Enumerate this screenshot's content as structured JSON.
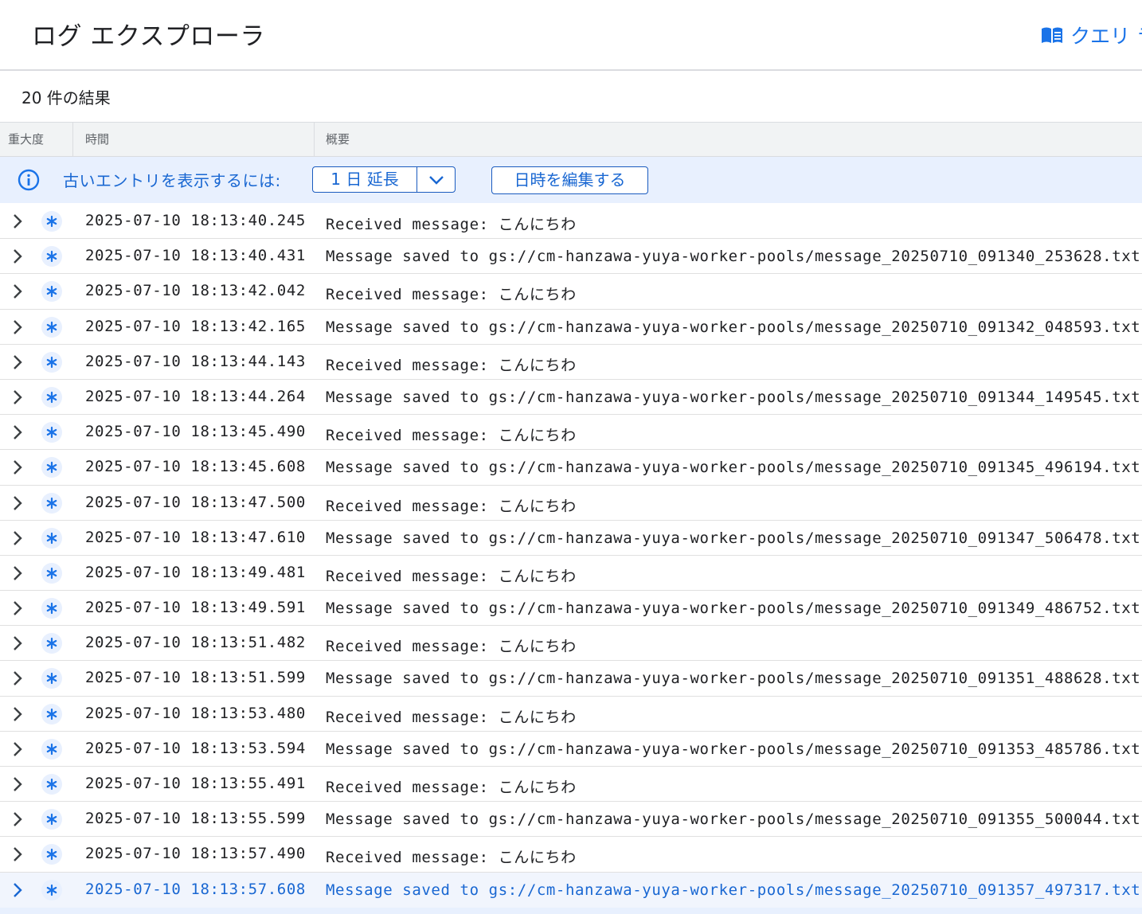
{
  "header": {
    "title": "ログ エクスプローラ",
    "query_link": "クエリ ラ",
    "query_icon": "library-book-icon"
  },
  "results": {
    "count_label": "20 件の結果"
  },
  "columns": {
    "severity": "重大度",
    "time": "時間",
    "summary": "概要"
  },
  "banner": {
    "icon": "info-icon",
    "text": "古いエントリを表示するには:",
    "extend_label": "1 日 延長",
    "edit_label": "日時を編集する"
  },
  "colors": {
    "accent": "#1a73e8",
    "banner_bg": "#e8f0fe",
    "severity_icon": "#1a73e8"
  },
  "rows": [
    {
      "time": "2025-07-10 18:13:40.245",
      "message": "Received message: こんにちわ"
    },
    {
      "time": "2025-07-10 18:13:40.431",
      "message": "Message saved to gs://cm-hanzawa-yuya-worker-pools/message_20250710_091340_253628.txt"
    },
    {
      "time": "2025-07-10 18:13:42.042",
      "message": "Received message: こんにちわ"
    },
    {
      "time": "2025-07-10 18:13:42.165",
      "message": "Message saved to gs://cm-hanzawa-yuya-worker-pools/message_20250710_091342_048593.txt"
    },
    {
      "time": "2025-07-10 18:13:44.143",
      "message": "Received message: こんにちわ"
    },
    {
      "time": "2025-07-10 18:13:44.264",
      "message": "Message saved to gs://cm-hanzawa-yuya-worker-pools/message_20250710_091344_149545.txt"
    },
    {
      "time": "2025-07-10 18:13:45.490",
      "message": "Received message: こんにちわ"
    },
    {
      "time": "2025-07-10 18:13:45.608",
      "message": "Message saved to gs://cm-hanzawa-yuya-worker-pools/message_20250710_091345_496194.txt"
    },
    {
      "time": "2025-07-10 18:13:47.500",
      "message": "Received message: こんにちわ"
    },
    {
      "time": "2025-07-10 18:13:47.610",
      "message": "Message saved to gs://cm-hanzawa-yuya-worker-pools/message_20250710_091347_506478.txt"
    },
    {
      "time": "2025-07-10 18:13:49.481",
      "message": "Received message: こんにちわ"
    },
    {
      "time": "2025-07-10 18:13:49.591",
      "message": "Message saved to gs://cm-hanzawa-yuya-worker-pools/message_20250710_091349_486752.txt"
    },
    {
      "time": "2025-07-10 18:13:51.482",
      "message": "Received message: こんにちわ"
    },
    {
      "time": "2025-07-10 18:13:51.599",
      "message": "Message saved to gs://cm-hanzawa-yuya-worker-pools/message_20250710_091351_488628.txt"
    },
    {
      "time": "2025-07-10 18:13:53.480",
      "message": "Received message: こんにちわ"
    },
    {
      "time": "2025-07-10 18:13:53.594",
      "message": "Message saved to gs://cm-hanzawa-yuya-worker-pools/message_20250710_091353_485786.txt"
    },
    {
      "time": "2025-07-10 18:13:55.491",
      "message": "Received message: こんにちわ"
    },
    {
      "time": "2025-07-10 18:13:55.599",
      "message": "Message saved to gs://cm-hanzawa-yuya-worker-pools/message_20250710_091355_500044.txt"
    },
    {
      "time": "2025-07-10 18:13:57.490",
      "message": "Received message: こんにちわ"
    },
    {
      "time": "2025-07-10 18:13:57.608",
      "message": "Message saved to gs://cm-hanzawa-yuya-worker-pools/message_20250710_091357_497317.txt",
      "selected": true
    }
  ]
}
